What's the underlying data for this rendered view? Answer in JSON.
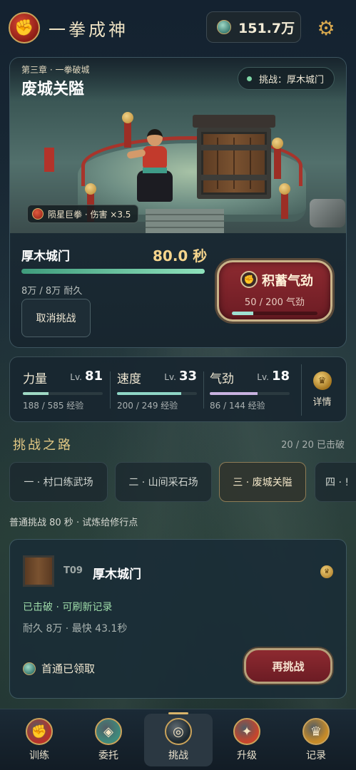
{
  "header": {
    "logo_glyph": "✊",
    "app_title": "一拳成神",
    "currency_value": "151.7万",
    "settings_glyph": "⚙"
  },
  "stage": {
    "chapter": "第三章 · 一拳破城",
    "title": "废城关隘",
    "challenge_label": "挑战：厚木城门",
    "buff": "陨星巨拳 · 伤害 ×3.5",
    "target_name": "厚木城门",
    "timer": "80.0 秒",
    "hp_fraction": 1.0,
    "hp_text": "8万 / 8万 耐久",
    "cancel_label": "取消挑战",
    "charge_label": "积蓄气劲",
    "charge_progress": "50 / 200 气劲",
    "charge_fraction": 0.25
  },
  "stats": {
    "items": [
      {
        "name": "力量",
        "lv_prefix": "Lv.",
        "level": "81",
        "exp": "188 / 585 经验",
        "fraction": 0.32,
        "color": "#9fd9c4"
      },
      {
        "name": "速度",
        "lv_prefix": "Lv.",
        "level": "33",
        "exp": "200 / 249 经验",
        "fraction": 0.8,
        "color": "#8fd6c6"
      },
      {
        "name": "气劲",
        "lv_prefix": "Lv.",
        "level": "18",
        "exp": "86 / 144 经验",
        "fraction": 0.6,
        "color": "#c9b2e0"
      }
    ],
    "detail_label": "详情"
  },
  "road": {
    "title": "挑战之路",
    "count": "20 / 20 已击破",
    "chapters": [
      {
        "label": "一 · 村口练武场"
      },
      {
        "label": "二 · 山间采石场"
      },
      {
        "label": "三 · 废城关隘"
      },
      {
        "label": "四 · !"
      }
    ],
    "description": "普通挑战 80 秒 · 试炼给修行点"
  },
  "target_card": {
    "id": "T09",
    "name": "厚木城门",
    "status": "已击破 · 可刷新记录",
    "info": "耐久 8万 · 最快 43.1秒",
    "reward": "首通已领取",
    "retry_label": "再挑战"
  },
  "nav": {
    "items": [
      {
        "label": "训练",
        "glyph": "✊",
        "color": "#b8322a"
      },
      {
        "label": "委托",
        "glyph": "◈",
        "color": "#3f8a7c"
      },
      {
        "label": "挑战",
        "glyph": "◎",
        "color": "#1e2a30"
      },
      {
        "label": "升级",
        "glyph": "✦",
        "color": "#c7452c"
      },
      {
        "label": "记录",
        "glyph": "♛",
        "color": "#c78b28"
      }
    ]
  }
}
